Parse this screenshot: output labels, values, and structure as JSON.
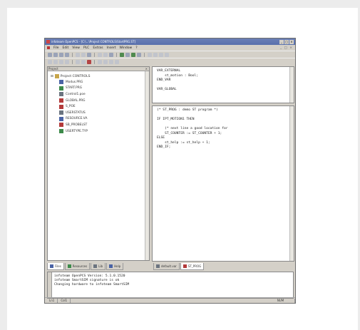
{
  "window": {
    "title": "infoteam OpenPCS - [C:\\...\\Project CONTROLS\\StartPRG.ST]"
  },
  "menu": [
    "File",
    "Edit",
    "View",
    "PLC",
    "Extras",
    "Insert",
    "Window",
    "?"
  ],
  "project": {
    "header": "Project",
    "root": "Project CONTROLS",
    "items": [
      {
        "label": "Modus.PRG",
        "icon": "program-icon"
      },
      {
        "label": "START.PRG",
        "icon": "program-icon"
      },
      {
        "label": "Control1.poe",
        "icon": "resource-icon"
      },
      {
        "label": "GLOBAL.PRG",
        "icon": "program-icon"
      },
      {
        "label": "S_POE",
        "icon": "pou-icon"
      },
      {
        "label": "USERSTATUS",
        "icon": "status-icon"
      },
      {
        "label": "RESOURCE.VA",
        "icon": "variable-icon"
      },
      {
        "label": "SB_PROBELST",
        "icon": "list-icon"
      },
      {
        "label": "USERTYPE.TYP",
        "icon": "type-icon"
      }
    ]
  },
  "left_tabs": [
    "Files",
    "Resources",
    "Lib",
    "Help"
  ],
  "right_tabs": [
    "default.var",
    "ST_PROG"
  ],
  "code_top": "VAR_EXTERNAL\n    st_motion : Bool;\nEND_VAR\n\nVAR_GLOBAL",
  "code_bottom": "(* ST_PROG : demo ST program *)\n\nIF IPT_MOTION1 THEN\n\n    (* next line a good location for\n    ST_COUNTER := ST_COUNTER + 1;\nELSE\n    st_help := st_help + 1;\nEND_IF;",
  "output": "infoteam OpenPCS Version: 5.1.0.1520\ninfoteam SmartSIM signature is ok\nChanging hardware to infoteam SmartSIM",
  "status": {
    "line": "Ln1",
    "col": "Col1",
    "mode": "NUM"
  }
}
